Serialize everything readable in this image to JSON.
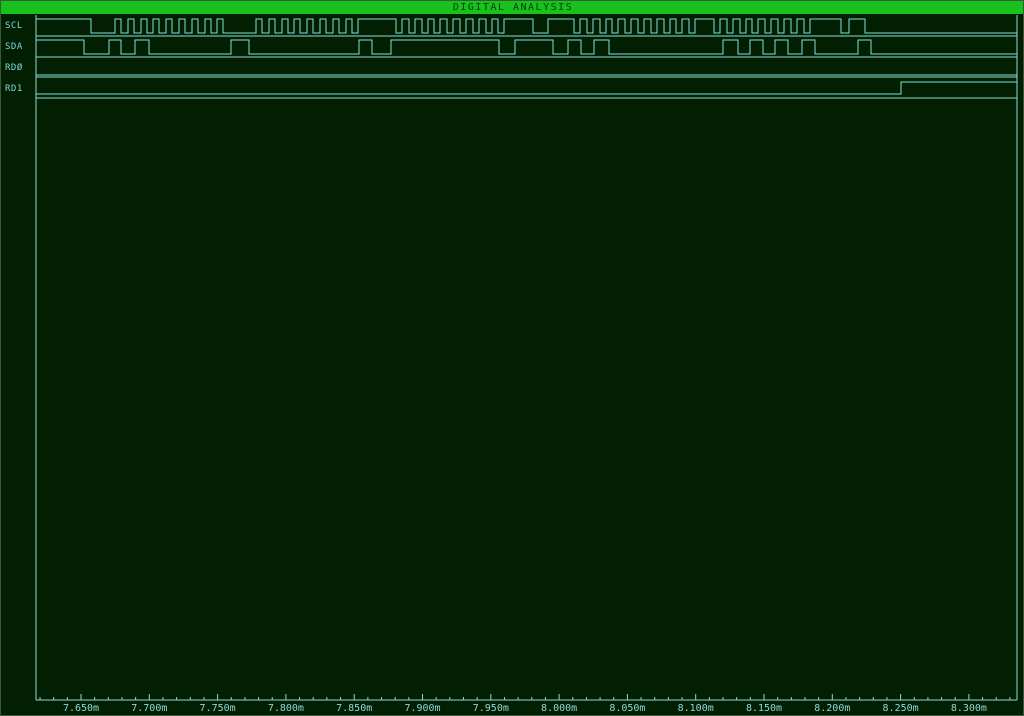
{
  "window": {
    "title": "DIGITAL ANALYSIS"
  },
  "colors": {
    "background": "#021f02",
    "title_bar": "#18c21c",
    "trace": "#7fe0e0",
    "grid": "#8fd8d8"
  },
  "signals": [
    {
      "name": "SCL",
      "label": "SCL"
    },
    {
      "name": "SDA",
      "label": "SDA"
    },
    {
      "name": "RD0",
      "label": "RDØ"
    },
    {
      "name": "RD1",
      "label": "RD1"
    }
  ],
  "x_axis": {
    "unit_suffix": "m",
    "ticks": [
      "7.650m",
      "7.700m",
      "7.750m",
      "7.800m",
      "7.850m",
      "7.900m",
      "7.950m",
      "8.000m",
      "8.050m",
      "8.100m",
      "8.150m",
      "8.200m",
      "8.250m",
      "8.300m"
    ]
  }
}
